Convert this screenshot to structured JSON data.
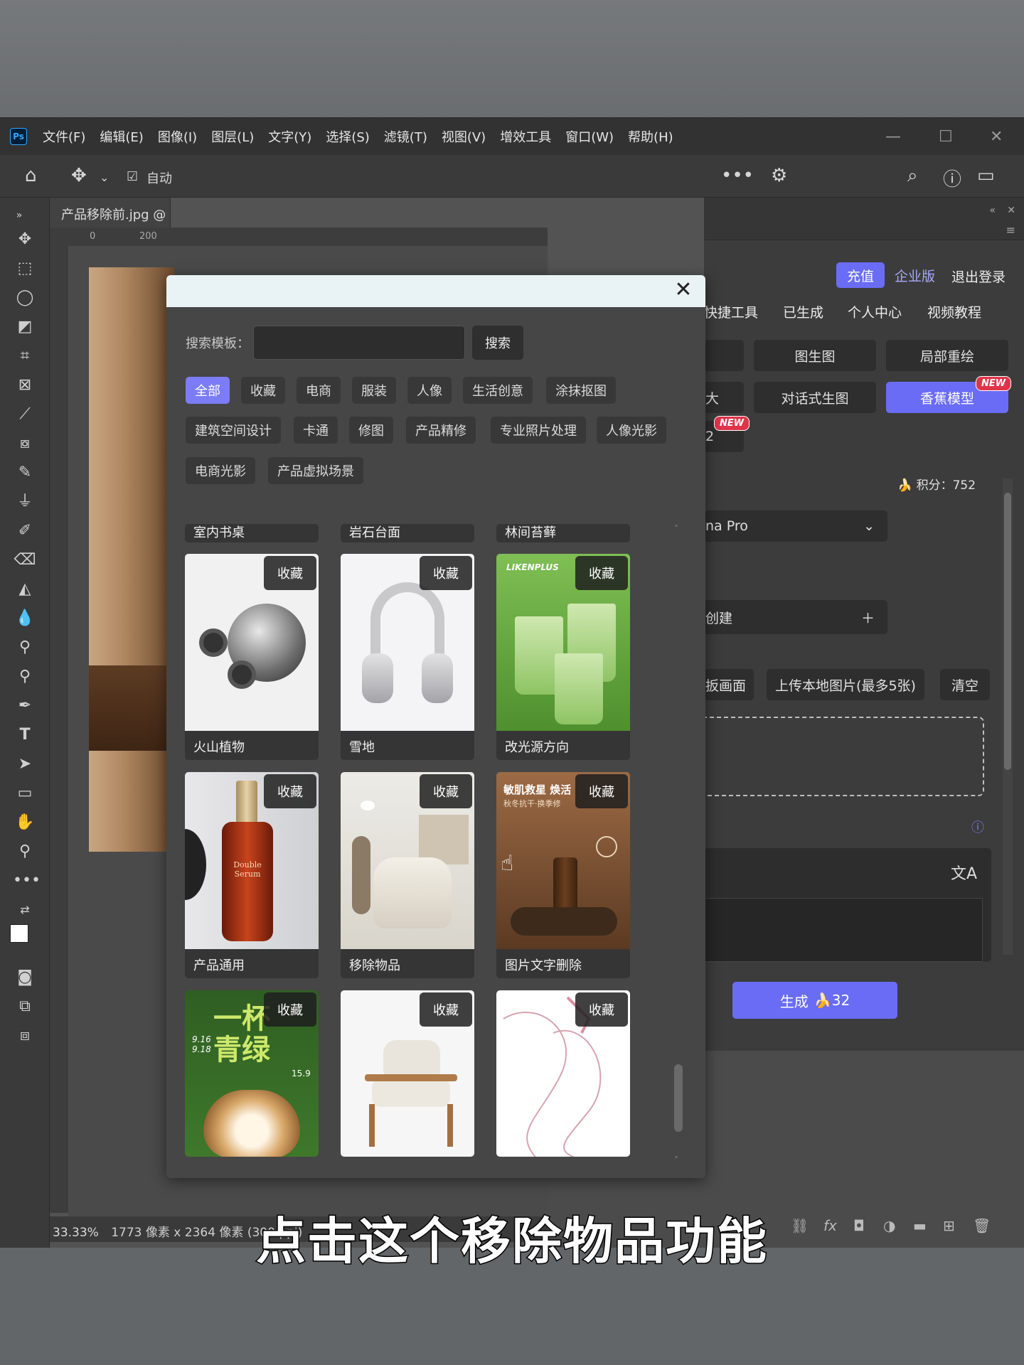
{
  "menubar": {
    "logo": "Ps",
    "items": [
      "文件(F)",
      "编辑(E)",
      "图像(I)",
      "图层(L)",
      "文字(Y)",
      "选择(S)",
      "滤镜(T)",
      "视图(V)",
      "增效工具",
      "窗口(W)",
      "帮助(H)"
    ]
  },
  "optionsbar": {
    "auto_label": "自动"
  },
  "document": {
    "tab_title": "产品移除前.jpg @",
    "ruler_ticks": [
      "0",
      "200"
    ],
    "zoom": "33.33%",
    "info": "1773 像素 x 2364 像素 (300 ppi)"
  },
  "modal": {
    "search_label": "搜索模板：",
    "search_placeholder": "",
    "search_button": "搜索",
    "categories": [
      "全部",
      "收藏",
      "电商",
      "服装",
      "人像",
      "生活创意",
      "涂抹抠图",
      "建筑空间设计",
      "卡通",
      "修图",
      "产品精修",
      "专业照片处理",
      "人像光影",
      "电商光影",
      "产品虚拟场景"
    ],
    "active_category": "全部",
    "partial_row": [
      "室内书桌",
      "岩石台面",
      "林间苔藓"
    ],
    "fav_label": "收藏",
    "cards": [
      {
        "label": "火山植物"
      },
      {
        "label": "雪地"
      },
      {
        "label": "改光源方向",
        "img_text": "LIKENPLUS"
      },
      {
        "label": "产品通用",
        "img_text": "Double Serum"
      },
      {
        "label": "移除物品"
      },
      {
        "label": "图片文字删除",
        "img_text": "敏肌救星 焕活",
        "img_text2": "秋冬抗干·换季修"
      },
      {
        "label": "",
        "img_text": "一杯青绿",
        "img_text2": "9.16 9.18",
        "img_text3": "15.9"
      },
      {
        "label": ""
      },
      {
        "label": ""
      }
    ]
  },
  "right_panel": {
    "recharge": "充值",
    "enterprise": "企业版",
    "logout": "退出登录",
    "tabs": [
      "快捷工具",
      "已生成",
      "个人中心",
      "视频教程"
    ],
    "buttons": [
      "图生图",
      "局部重绘",
      "对话式生图",
      "香蕉模型"
    ],
    "partial_left": [
      "大",
      "2"
    ],
    "new_badge": "NEW",
    "points": "积分：752",
    "model_select": "na Pro",
    "create_label": "创建",
    "upload_buttons": [
      "扳画面",
      "上传本地图片(最多5张)",
      "清空"
    ],
    "generate_label": "生成",
    "generate_cost": "32"
  },
  "subtitle": "点击这个移除物品功能"
}
